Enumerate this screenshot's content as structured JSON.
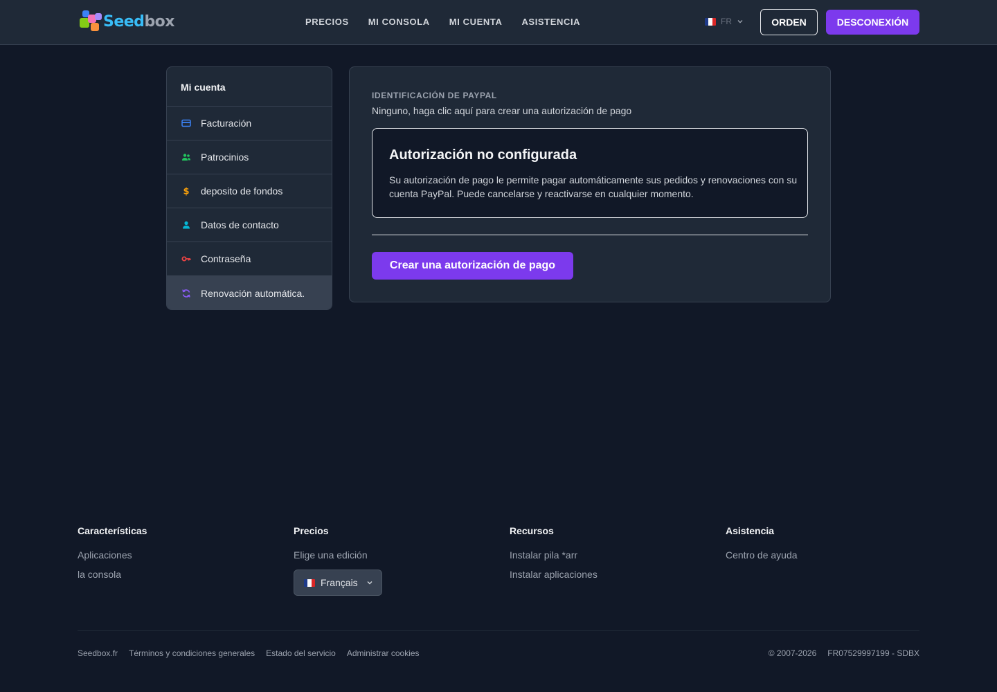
{
  "header": {
    "logo_part1": "Seed",
    "logo_part2": "box",
    "nav": [
      "PRECIOS",
      "MI CONSOLA",
      "MI CUENTA",
      "ASISTENCIA"
    ],
    "lang_code": "FR",
    "order_label": "ORDEN",
    "logout_label": "DESCONEXIÓN"
  },
  "sidebar": {
    "title": "Mi cuenta",
    "items": [
      {
        "label": "Facturación",
        "icon": "credit-card-icon",
        "color": "#3b82f6"
      },
      {
        "label": "Patrocinios",
        "icon": "users-icon",
        "color": "#22c55e"
      },
      {
        "label": "deposito de fondos",
        "icon": "dollar-icon",
        "color": "#f59e0b"
      },
      {
        "label": "Datos de contacto",
        "icon": "user-icon",
        "color": "#06b6d4"
      },
      {
        "label": "Contraseña",
        "icon": "key-icon",
        "color": "#ef4444"
      },
      {
        "label": "Renovación automática.",
        "icon": "refresh-icon",
        "color": "#8b5cf6"
      }
    ],
    "active_index": 5
  },
  "main": {
    "paypal_label": "IDENTIFICACIÓN DE PAYPAL",
    "paypal_value": "Ninguno, haga clic aquí para crear una autorización de pago",
    "auth_title": "Autorización no configurada",
    "auth_desc": "Su autorización de pago le permite pagar automáticamente sus pedidos y renovaciones con su cuenta PayPal. Puede cancelarse y reactivarse en cualquier momento.",
    "create_button": "Crear una autorización de pago"
  },
  "footer": {
    "columns": [
      {
        "title": "Características",
        "links": [
          "Aplicaciones",
          "la consola"
        ]
      },
      {
        "title": "Precios",
        "links": [
          "Elige una edición"
        ]
      },
      {
        "title": "Recursos",
        "links": [
          "Instalar pila *arr",
          "Instalar aplicaciones"
        ]
      },
      {
        "title": "Asistencia",
        "links": [
          "Centro de ayuda"
        ]
      }
    ],
    "language_select": "Français",
    "bottom_links": [
      "Seedbox.fr",
      "Términos y condiciones generales",
      "Estado del servicio",
      "Administrar cookies"
    ],
    "copyright": "© 2007-2026",
    "company_id": "FR07529997199 - SDBX"
  },
  "colors": {
    "accent": "#7c3aed",
    "background": "#111827",
    "panel": "#1f2937"
  }
}
